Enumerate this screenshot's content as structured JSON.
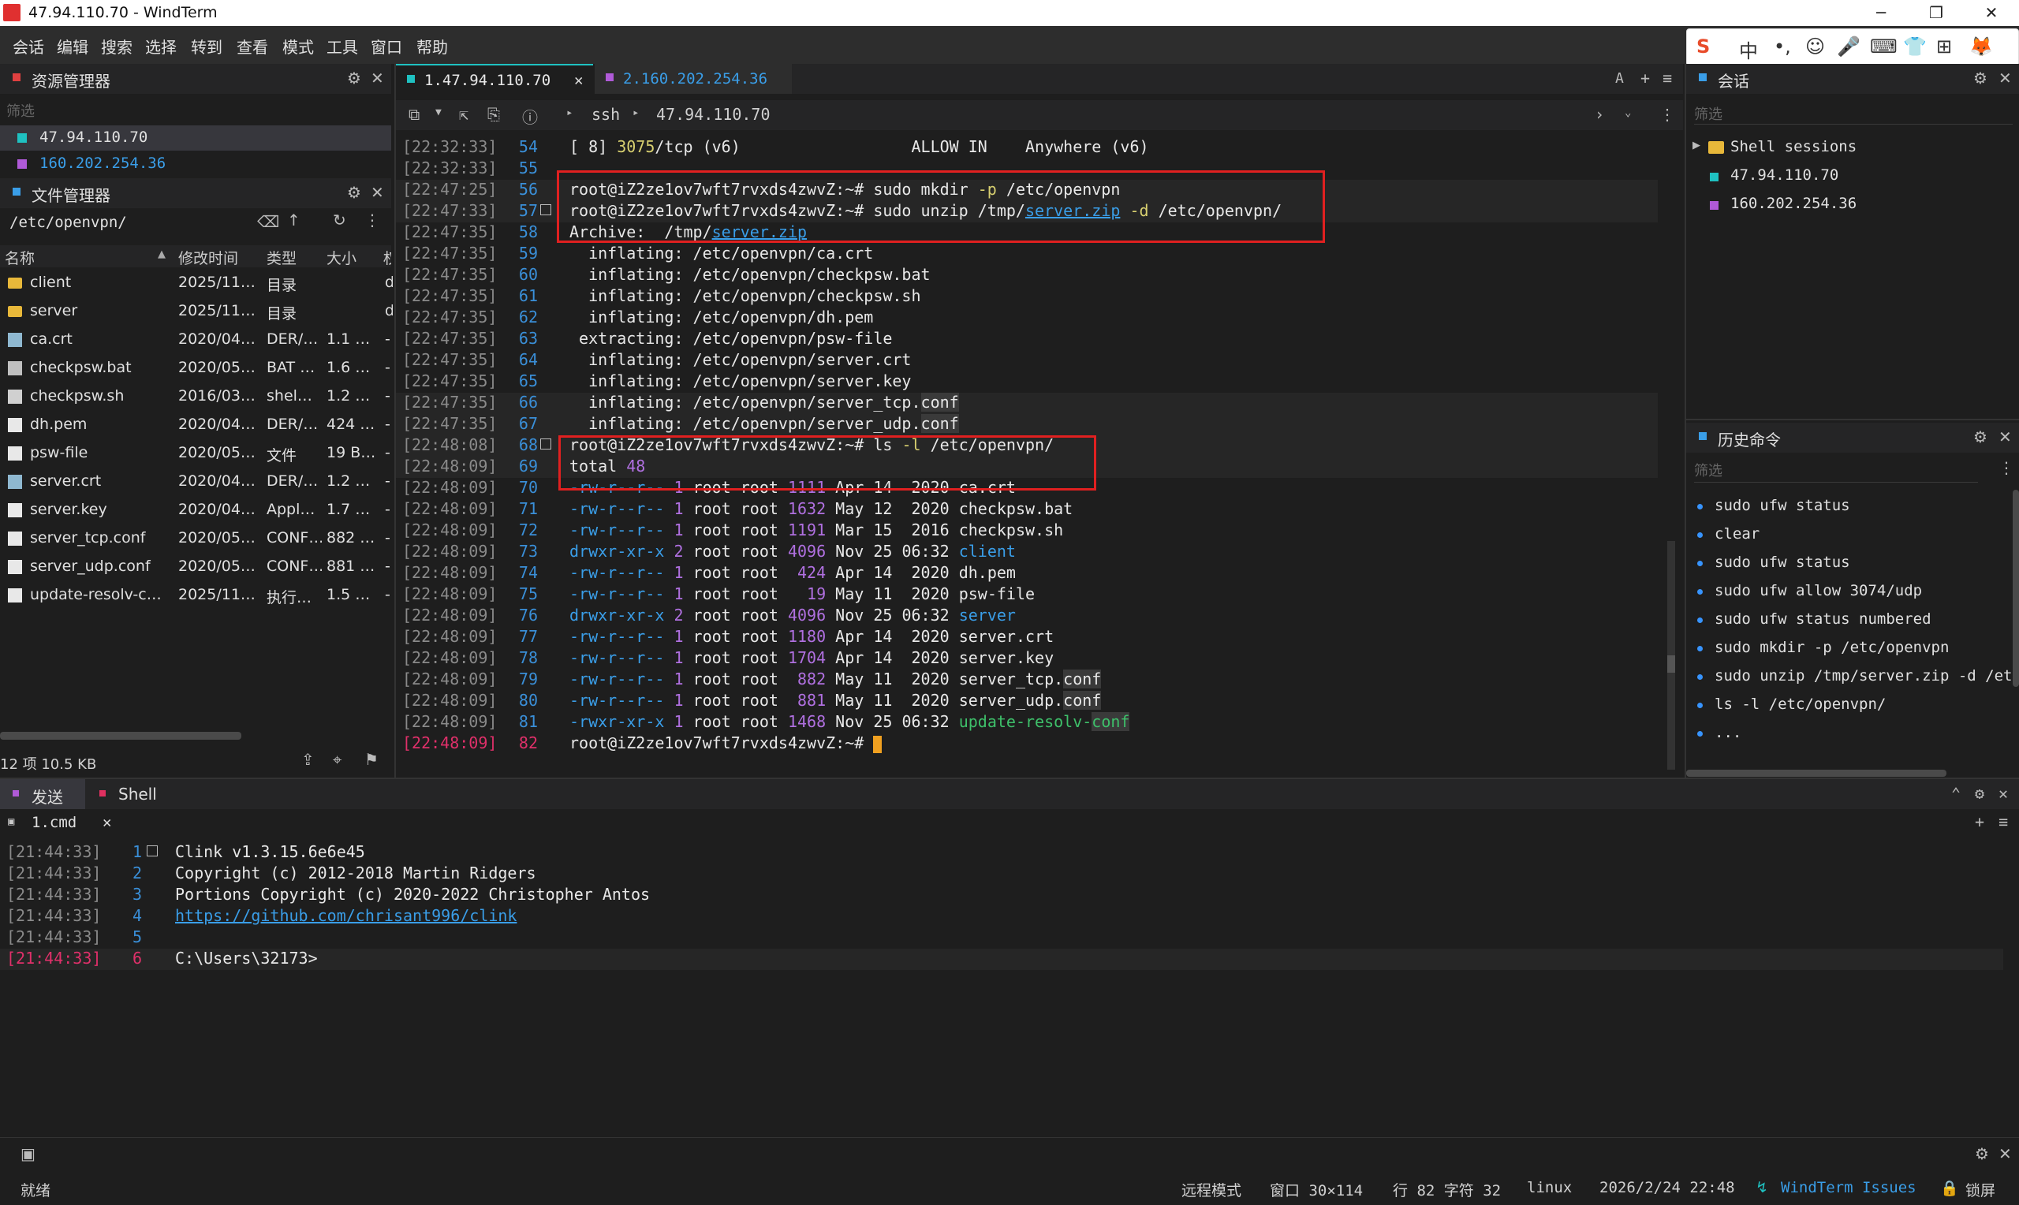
{
  "window": {
    "title": "47.94.110.70 - WindTerm",
    "min": "─",
    "max": "❐",
    "close": "✕"
  },
  "menu": [
    "会话",
    "编辑",
    "搜索",
    "选择",
    "转到",
    "查看",
    "模式",
    "工具",
    "窗口",
    "帮助"
  ],
  "ime": [
    "S",
    "中",
    "•,",
    "☺",
    "🎤",
    "⌨",
    "👕",
    "⊞",
    "🦊"
  ],
  "resource_manager": {
    "title": "资源管理器",
    "filter_placeholder": "筛选",
    "hosts": [
      {
        "name": "47.94.110.70",
        "color": "#1fc1c1"
      },
      {
        "name": "160.202.254.36",
        "color": "#b05ad8"
      }
    ]
  },
  "file_manager": {
    "title": "文件管理器",
    "path": "/etc/openvpn/",
    "columns": [
      "名称",
      "修改时间",
      "类型",
      "大小",
      "权"
    ],
    "rows": [
      {
        "name": "client",
        "time": "2025/11…",
        "type": "目录",
        "size": "",
        "perm": "d",
        "icon": "folder"
      },
      {
        "name": "server",
        "time": "2025/11…",
        "type": "目录",
        "size": "",
        "perm": "d",
        "icon": "folder"
      },
      {
        "name": "ca.crt",
        "time": "2020/04…",
        "type": "DER/…",
        "size": "1.1 …",
        "perm": "-",
        "icon": "cert"
      },
      {
        "name": "checkpsw.bat",
        "time": "2020/05…",
        "type": "BAT …",
        "size": "1.6 …",
        "perm": "-",
        "icon": "bat"
      },
      {
        "name": "checkpsw.sh",
        "time": "2016/03…",
        "type": "shel…",
        "size": "1.2 …",
        "perm": "-",
        "icon": "sh"
      },
      {
        "name": "dh.pem",
        "time": "2020/04…",
        "type": "DER/…",
        "size": "424 …",
        "perm": "-",
        "icon": "file"
      },
      {
        "name": "psw-file",
        "time": "2020/05…",
        "type": "文件",
        "size": "19 B…",
        "perm": "-",
        "icon": "file"
      },
      {
        "name": "server.crt",
        "time": "2020/04…",
        "type": "DER/…",
        "size": "1.2 …",
        "perm": "-",
        "icon": "cert"
      },
      {
        "name": "server.key",
        "time": "2020/04…",
        "type": "Appl…",
        "size": "1.7 …",
        "perm": "-",
        "icon": "file"
      },
      {
        "name": "server_tcp.conf",
        "time": "2020/05…",
        "type": "CONF…",
        "size": "882 …",
        "perm": "-",
        "icon": "file"
      },
      {
        "name": "server_udp.conf",
        "time": "2020/05…",
        "type": "CONF…",
        "size": "881 …",
        "perm": "-",
        "icon": "file"
      },
      {
        "name": "update-resolv-c…",
        "time": "2025/11…",
        "type": "执行…",
        "size": "1.5 …",
        "perm": "-",
        "icon": "file"
      }
    ],
    "footer": "12 项 10.5 KB"
  },
  "terminal": {
    "tabs": [
      {
        "label": "1.47.94.110.70",
        "active": true,
        "color": "#1fc1c1",
        "close": "✕"
      },
      {
        "label": "2.160.202.254.36",
        "active": false,
        "color": "#b05ad8"
      }
    ],
    "breadcrumb": [
      "ssh",
      "47.94.110.70"
    ],
    "lines": [
      {
        "ts": "[22:32:33]",
        "ln": "54",
        "segs": [
          [
            "[ 8] ",
            "#e8e8e8"
          ],
          [
            "3075",
            "#d8d070"
          ],
          [
            "/tcp (v6)                  ALLOW IN    Anywhere (v6)",
            "#e8e8e8"
          ]
        ]
      },
      {
        "ts": "[22:32:33]",
        "ln": "55",
        "segs": []
      },
      {
        "ts": "[22:47:25]",
        "ln": "56",
        "segs": [
          [
            "root@iZ2ze1ov7wft7rvxds4zwvZ:~# ",
            "#e8e8e8"
          ],
          [
            "sudo mkdir ",
            "#e8e8e8"
          ],
          [
            "-p",
            "#d8d070"
          ],
          [
            " /etc/openvpn",
            "#e8e8e8"
          ]
        ]
      },
      {
        "ts": "[22:47:33]",
        "ln": "57",
        "segs": [
          [
            "root@iZ2ze1ov7wft7rvxds4zwvZ:~# ",
            "#e8e8e8"
          ],
          [
            "sudo unzip /tmp/",
            "#e8e8e8"
          ],
          [
            "server.zip",
            "#3a9ee8"
          ],
          [
            " ",
            "#e8e8e8"
          ],
          [
            "-d",
            "#d8d070"
          ],
          [
            " /etc/openvpn/",
            "#e8e8e8"
          ]
        ]
      },
      {
        "ts": "[22:47:35]",
        "ln": "58",
        "segs": [
          [
            "Archive:  /tmp/",
            "#e8e8e8"
          ],
          [
            "server.zip",
            "#3a9ee8"
          ]
        ]
      },
      {
        "ts": "[22:47:35]",
        "ln": "59",
        "segs": [
          [
            "  inflating: /etc/openvpn/ca.crt",
            "#e8e8e8"
          ]
        ]
      },
      {
        "ts": "[22:47:35]",
        "ln": "60",
        "segs": [
          [
            "  inflating: /etc/openvpn/checkpsw.bat",
            "#e8e8e8"
          ]
        ]
      },
      {
        "ts": "[22:47:35]",
        "ln": "61",
        "segs": [
          [
            "  inflating: /etc/openvpn/checkpsw.sh",
            "#e8e8e8"
          ]
        ]
      },
      {
        "ts": "[22:47:35]",
        "ln": "62",
        "segs": [
          [
            "  inflating: /etc/openvpn/dh.pem",
            "#e8e8e8"
          ]
        ]
      },
      {
        "ts": "[22:47:35]",
        "ln": "63",
        "segs": [
          [
            " extracting: /etc/openvpn/psw-file",
            "#e8e8e8"
          ]
        ]
      },
      {
        "ts": "[22:47:35]",
        "ln": "64",
        "segs": [
          [
            "  inflating: /etc/openvpn/server.crt",
            "#e8e8e8"
          ]
        ]
      },
      {
        "ts": "[22:47:35]",
        "ln": "65",
        "segs": [
          [
            "  inflating: /etc/openvpn/server.key",
            "#e8e8e8"
          ]
        ]
      },
      {
        "ts": "[22:47:35]",
        "ln": "66",
        "segs": [
          [
            "  inflating: /etc/openvpn/server_tcp.",
            "#e8e8e8"
          ],
          [
            "conf",
            "#e8e8e8"
          ]
        ]
      },
      {
        "ts": "[22:47:35]",
        "ln": "67",
        "segs": [
          [
            "  inflating: /etc/openvpn/server_udp.",
            "#e8e8e8"
          ],
          [
            "conf",
            "#e8e8e8"
          ]
        ]
      },
      {
        "ts": "[22:48:08]",
        "ln": "68",
        "segs": [
          [
            "root@iZ2ze1ov7wft7rvxds4zwvZ:~# ",
            "#e8e8e8"
          ],
          [
            "ls ",
            "#e8e8e8"
          ],
          [
            "-l",
            "#d8d070"
          ],
          [
            " /etc/openvpn/",
            "#e8e8e8"
          ]
        ]
      },
      {
        "ts": "[22:48:09]",
        "ln": "69",
        "segs": [
          [
            "total ",
            "#e8e8e8"
          ],
          [
            "48",
            "#b070e0"
          ]
        ]
      },
      {
        "ts": "[22:48:09]",
        "ln": "70",
        "segs": [
          [
            "-rw-r--r--",
            "#3a9ee8"
          ],
          [
            " 1 ",
            "#b070e0"
          ],
          [
            "root root ",
            "#e8e8e8"
          ],
          [
            "1111",
            "#b070e0"
          ],
          [
            " Apr 14  2020 ",
            "#e8e8e8"
          ],
          [
            "ca.crt",
            "#e8e8e8"
          ]
        ]
      },
      {
        "ts": "[22:48:09]",
        "ln": "71",
        "segs": [
          [
            "-rw-r--r--",
            "#3a9ee8"
          ],
          [
            " 1 ",
            "#b070e0"
          ],
          [
            "root root ",
            "#e8e8e8"
          ],
          [
            "1632",
            "#b070e0"
          ],
          [
            " May 12  2020 ",
            "#e8e8e8"
          ],
          [
            "checkpsw.bat",
            "#e8e8e8"
          ]
        ]
      },
      {
        "ts": "[22:48:09]",
        "ln": "72",
        "segs": [
          [
            "-rw-r--r--",
            "#3a9ee8"
          ],
          [
            " 1 ",
            "#b070e0"
          ],
          [
            "root root ",
            "#e8e8e8"
          ],
          [
            "1191",
            "#b070e0"
          ],
          [
            " Mar 15  2016 ",
            "#e8e8e8"
          ],
          [
            "checkpsw.sh",
            "#e8e8e8"
          ]
        ]
      },
      {
        "ts": "[22:48:09]",
        "ln": "73",
        "segs": [
          [
            "drwxr-xr-x",
            "#3a9ee8"
          ],
          [
            " 2 ",
            "#b070e0"
          ],
          [
            "root root ",
            "#e8e8e8"
          ],
          [
            "4096",
            "#b070e0"
          ],
          [
            " Nov 25 06:32 ",
            "#e8e8e8"
          ],
          [
            "client",
            "#3a9ee8"
          ]
        ]
      },
      {
        "ts": "[22:48:09]",
        "ln": "74",
        "segs": [
          [
            "-rw-r--r--",
            "#3a9ee8"
          ],
          [
            " 1 ",
            "#b070e0"
          ],
          [
            "root root ",
            "#e8e8e8"
          ],
          [
            " 424",
            "#b070e0"
          ],
          [
            " Apr 14  2020 ",
            "#e8e8e8"
          ],
          [
            "dh.pem",
            "#e8e8e8"
          ]
        ]
      },
      {
        "ts": "[22:48:09]",
        "ln": "75",
        "segs": [
          [
            "-rw-r--r--",
            "#3a9ee8"
          ],
          [
            " 1 ",
            "#b070e0"
          ],
          [
            "root root ",
            "#e8e8e8"
          ],
          [
            "  19",
            "#b070e0"
          ],
          [
            " May 11  2020 ",
            "#e8e8e8"
          ],
          [
            "psw-file",
            "#e8e8e8"
          ]
        ]
      },
      {
        "ts": "[22:48:09]",
        "ln": "76",
        "segs": [
          [
            "drwxr-xr-x",
            "#3a9ee8"
          ],
          [
            " 2 ",
            "#b070e0"
          ],
          [
            "root root ",
            "#e8e8e8"
          ],
          [
            "4096",
            "#b070e0"
          ],
          [
            " Nov 25 06:32 ",
            "#e8e8e8"
          ],
          [
            "server",
            "#3a9ee8"
          ]
        ]
      },
      {
        "ts": "[22:48:09]",
        "ln": "77",
        "segs": [
          [
            "-rw-r--r--",
            "#3a9ee8"
          ],
          [
            " 1 ",
            "#b070e0"
          ],
          [
            "root root ",
            "#e8e8e8"
          ],
          [
            "1180",
            "#b070e0"
          ],
          [
            " Apr 14  2020 ",
            "#e8e8e8"
          ],
          [
            "server.crt",
            "#e8e8e8"
          ]
        ]
      },
      {
        "ts": "[22:48:09]",
        "ln": "78",
        "segs": [
          [
            "-rw-r--r--",
            "#3a9ee8"
          ],
          [
            " 1 ",
            "#b070e0"
          ],
          [
            "root root ",
            "#e8e8e8"
          ],
          [
            "1704",
            "#b070e0"
          ],
          [
            " Apr 14  2020 ",
            "#e8e8e8"
          ],
          [
            "server.key",
            "#e8e8e8"
          ]
        ]
      },
      {
        "ts": "[22:48:09]",
        "ln": "79",
        "segs": [
          [
            "-rw-r--r--",
            "#3a9ee8"
          ],
          [
            " 1 ",
            "#b070e0"
          ],
          [
            "root root ",
            "#e8e8e8"
          ],
          [
            " 882",
            "#b070e0"
          ],
          [
            " May 11  2020 ",
            "#e8e8e8"
          ],
          [
            "server_tcp.",
            "#e8e8e8"
          ],
          [
            "conf",
            "#e8e8e8"
          ]
        ]
      },
      {
        "ts": "[22:48:09]",
        "ln": "80",
        "segs": [
          [
            "-rw-r--r--",
            "#3a9ee8"
          ],
          [
            " 1 ",
            "#b070e0"
          ],
          [
            "root root ",
            "#e8e8e8"
          ],
          [
            " 881",
            "#b070e0"
          ],
          [
            " May 11  2020 ",
            "#e8e8e8"
          ],
          [
            "server_udp.",
            "#e8e8e8"
          ],
          [
            "conf",
            "#e8e8e8"
          ]
        ]
      },
      {
        "ts": "[22:48:09]",
        "ln": "81",
        "segs": [
          [
            "-rwxr-xr-x",
            "#3a9ee8"
          ],
          [
            " 1 ",
            "#b070e0"
          ],
          [
            "root root ",
            "#e8e8e8"
          ],
          [
            "1468",
            "#b070e0"
          ],
          [
            " Nov 25 06:32 ",
            "#e8e8e8"
          ],
          [
            "update-resolv-",
            "#3ec06a"
          ],
          [
            "conf",
            "#3ec06a"
          ]
        ]
      },
      {
        "ts": "[22:48:09]",
        "ln": "82",
        "segs": [
          [
            "root@iZ2ze1ov7wft7rvxds4zwvZ:~# ",
            "#e8e8e8"
          ]
        ]
      }
    ]
  },
  "sessions": {
    "title": "会话",
    "filter_placeholder": "筛选",
    "group": "Shell sessions",
    "items": [
      {
        "name": "47.94.110.70",
        "color": "#1fc1c1"
      },
      {
        "name": "160.202.254.36",
        "color": "#b05ad8"
      }
    ]
  },
  "history": {
    "title": "历史命令",
    "filter_placeholder": "筛选",
    "items": [
      "sudo ufw status",
      "clear",
      "sudo ufw status",
      "sudo ufw allow 3074/udp",
      "sudo ufw status numbered",
      "sudo mkdir -p /etc/openvpn",
      "sudo unzip /tmp/server.zip -d /etc/",
      "ls -l /etc/openvpn/",
      "..."
    ]
  },
  "bottom": {
    "tabs": [
      "发送",
      "Shell"
    ],
    "subtab": "1.cmd",
    "lines": [
      {
        "ts": "[21:44:33]",
        "ln": "1",
        "text": "Clink v1.3.15.6e6e45"
      },
      {
        "ts": "[21:44:33]",
        "ln": "2",
        "text": "Copyright (c) 2012-2018 Martin Ridgers"
      },
      {
        "ts": "[21:44:33]",
        "ln": "3",
        "text": "Portions Copyright (c) 2020-2022 Christopher Antos"
      },
      {
        "ts": "[21:44:33]",
        "ln": "4",
        "text": "https://github.com/chrisant996/clink"
      },
      {
        "ts": "[21:44:33]",
        "ln": "5",
        "text": ""
      },
      {
        "ts": "[21:44:33]",
        "ln": "6",
        "text": "C:\\Users\\32173>"
      }
    ]
  },
  "status": {
    "ready": "就绪",
    "mode": "远程模式",
    "window": "窗口 30×114",
    "cursor": "行 82 字符 32",
    "os": "linux",
    "datetime": "2026/2/24 22:48",
    "link": "WindTerm Issues",
    "lock": "锁屏"
  }
}
